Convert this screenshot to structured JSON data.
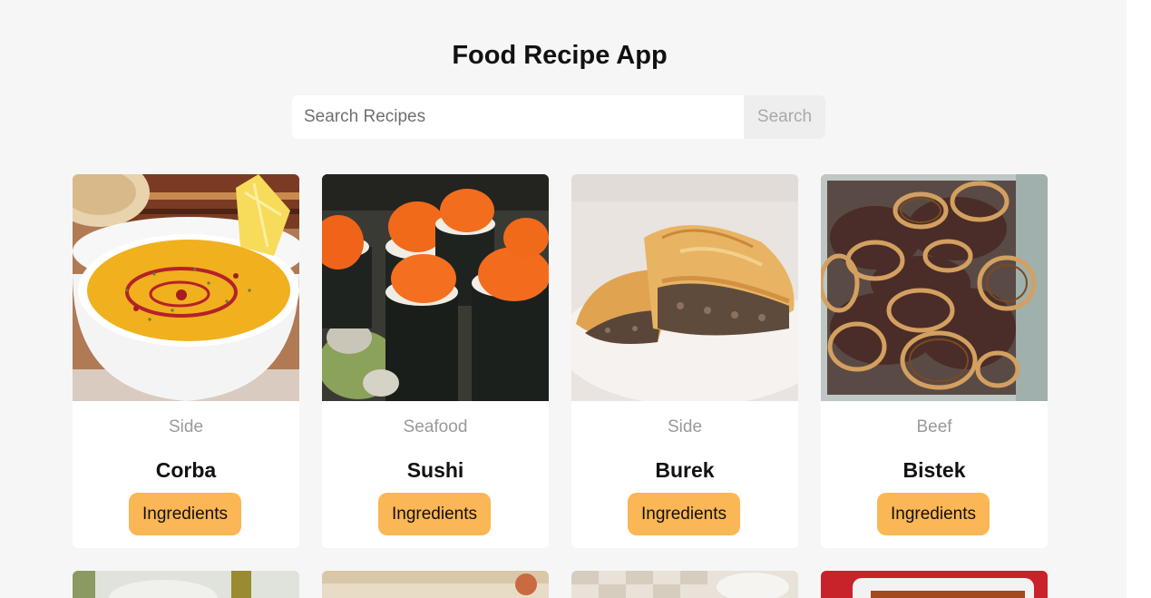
{
  "header": {
    "title": "Food Recipe App"
  },
  "search": {
    "placeholder": "Search Recipes",
    "value": "",
    "button_label": "Search"
  },
  "recipes": [
    {
      "category": "Side",
      "name": "Corba",
      "button_label": "Ingredients"
    },
    {
      "category": "Seafood",
      "name": "Sushi",
      "button_label": "Ingredients"
    },
    {
      "category": "Side",
      "name": "Burek",
      "button_label": "Ingredients"
    },
    {
      "category": "Beef",
      "name": "Bistek",
      "button_label": "Ingredients"
    }
  ],
  "colors": {
    "background": "#f6f6f6",
    "card": "#ffffff",
    "accent_button": "#fbb655",
    "category_text": "#9a9a9a"
  }
}
